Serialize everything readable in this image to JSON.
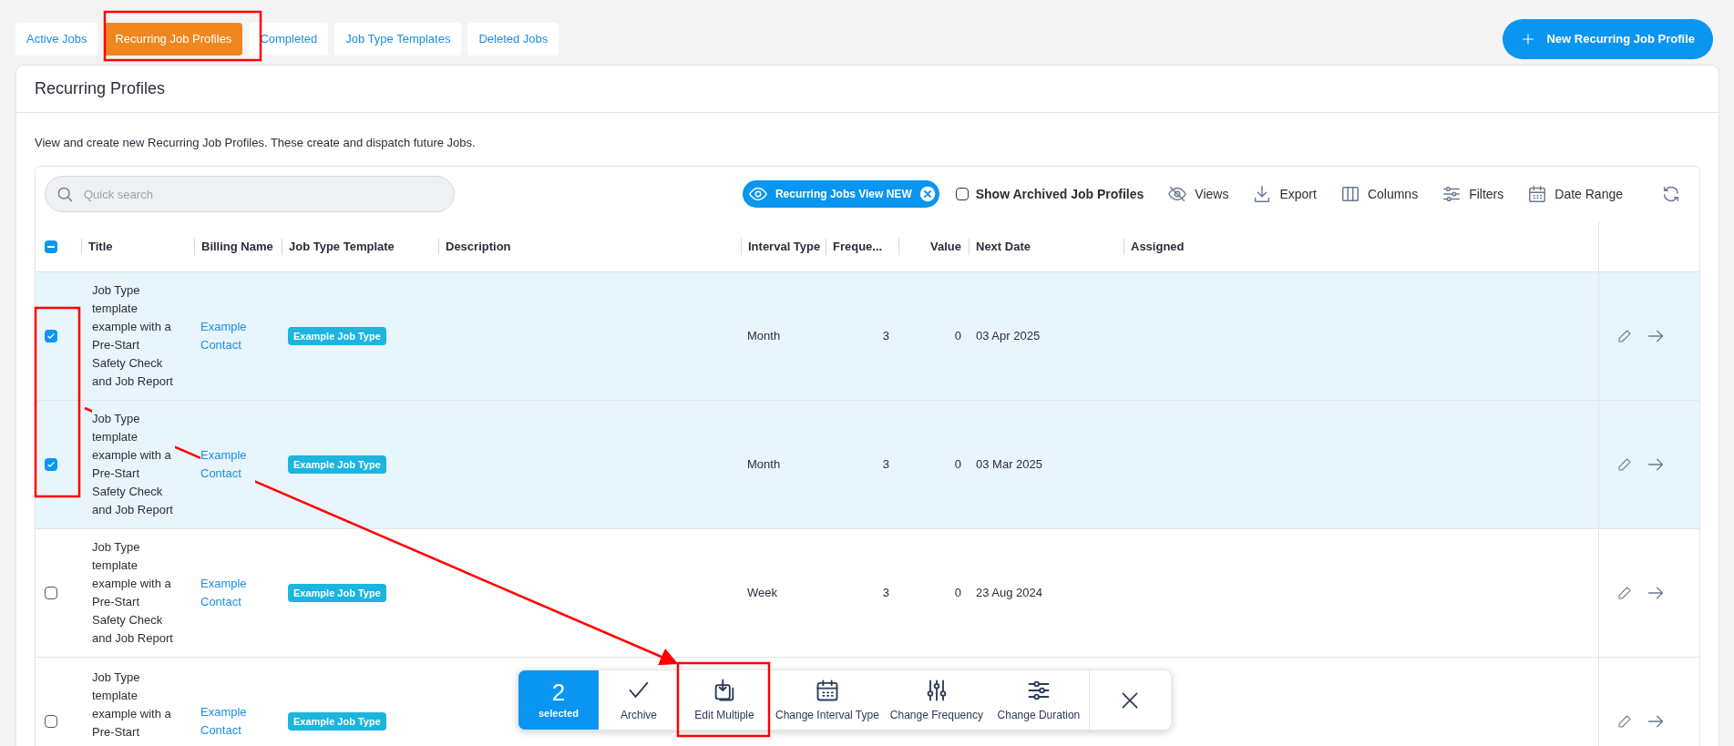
{
  "tabs": [
    {
      "label": "Active Jobs",
      "selected": false
    },
    {
      "label": "Recurring Job Profiles",
      "selected": true
    },
    {
      "label": "Completed",
      "selected": false
    },
    {
      "label": "Job Type Templates",
      "selected": false
    },
    {
      "label": "Deleted Jobs",
      "selected": false
    }
  ],
  "new_button": {
    "label": "New Recurring Job Profile"
  },
  "card": {
    "title": "Recurring Profiles",
    "description": "View and create new Recurring Job Profiles. These create and dispatch future Jobs."
  },
  "search": {
    "placeholder": "Quick search"
  },
  "view_chip": {
    "label": "Recurring Jobs View NEW"
  },
  "show_archived": {
    "label": "Show Archived Job Profiles",
    "checked": false
  },
  "toolbar": [
    {
      "kind": "views",
      "label": "Views"
    },
    {
      "kind": "export",
      "label": "Export"
    },
    {
      "kind": "columns",
      "label": "Columns"
    },
    {
      "kind": "filters",
      "label": "Filters"
    },
    {
      "kind": "date_range",
      "label": "Date Range"
    },
    {
      "kind": "refresh"
    }
  ],
  "table": {
    "select_all_indeterminate": true,
    "columns": [
      "Title",
      "Billing Name",
      "Job Type Template",
      "Description",
      "Interval Type",
      "Freque...",
      "Value",
      "Next Date",
      "Assigned"
    ],
    "rows": [
      {
        "selected": true,
        "title": "Job Type template example with a Pre-Start Safety Check and Job Report",
        "billing_name": "Example Contact",
        "job_type_template": "Example Job Type",
        "interval_type": "Month",
        "frequency": "3",
        "value": "0",
        "next_date": "03 Apr 2025"
      },
      {
        "selected": true,
        "title": "Job Type template example with a Pre-Start Safety Check and Job Report",
        "billing_name": "Example Contact",
        "job_type_template": "Example Job Type",
        "interval_type": "Month",
        "frequency": "3",
        "value": "0",
        "next_date": "03 Mar 2025"
      },
      {
        "selected": false,
        "title": "Job Type template example with a Pre-Start Safety Check and Job Report",
        "billing_name": "Example Contact",
        "job_type_template": "Example Job Type",
        "interval_type": "Week",
        "frequency": "3",
        "value": "0",
        "next_date": "23 Aug 2024"
      },
      {
        "selected": false,
        "title": "Job Type template example with a Pre-Start",
        "billing_name": "Example Contact",
        "job_type_template": "Example Job Type"
      }
    ]
  },
  "bulk_bar": {
    "count": "2",
    "count_label": "selected",
    "actions": [
      {
        "kind": "archive",
        "label": "Archive"
      },
      {
        "kind": "edit_multiple",
        "label": "Edit Multiple"
      },
      {
        "kind": "interval",
        "label": "Change Interval Type"
      },
      {
        "kind": "frequency",
        "label": "Change Frequency"
      },
      {
        "kind": "duration",
        "label": "Change Duration"
      },
      {
        "kind": "close"
      }
    ]
  }
}
